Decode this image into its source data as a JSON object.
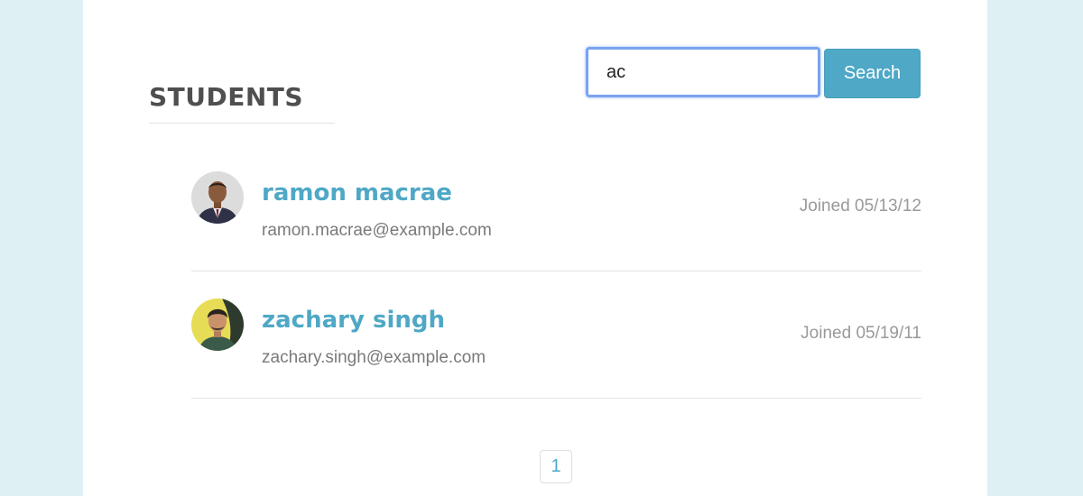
{
  "heading": "STUDENTS",
  "search": {
    "value": "ac",
    "button_label": "Search"
  },
  "students": [
    {
      "name": "ramon macrae",
      "email": "ramon.macrae@example.com",
      "joined": "Joined 05/13/12",
      "avatar_colors": {
        "bg": "#dcdcdc",
        "skin": "#8a5a3c",
        "suit": "#2f3247",
        "tie": "#7a2a36"
      }
    },
    {
      "name": "zachary singh",
      "email": "zachary.singh@example.com",
      "joined": "Joined 05/19/11",
      "avatar_colors": {
        "bg": "#e7dc55",
        "skin": "#c9926b",
        "hair": "#2a2420",
        "shirt": "#3a5a4a"
      }
    }
  ],
  "pagination": {
    "pages": [
      "1"
    ]
  },
  "colors": {
    "background": "#dff0f5",
    "accent": "#4ea8c6",
    "heading": "#4f4f4f",
    "muted": "#9a9a9a"
  }
}
